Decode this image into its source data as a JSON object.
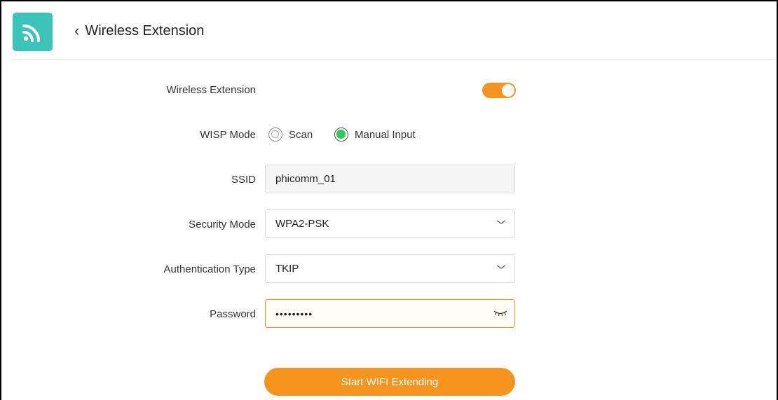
{
  "header": {
    "title": "Wireless Extension",
    "logo_icon": "wifi-signal-icon",
    "back_icon": "chevron-left-icon"
  },
  "form": {
    "wireless_extension": {
      "label": "Wireless Extension",
      "enabled": true
    },
    "wisp_mode": {
      "label": "WISP Mode",
      "options": [
        "Scan",
        "Manual Input"
      ],
      "selected": "Manual Input"
    },
    "ssid": {
      "label": "SSID",
      "value": "phicomm_01"
    },
    "security_mode": {
      "label": "Security Mode",
      "value": "WPA2-PSK"
    },
    "authentication_type": {
      "label": "Authentication Type",
      "value": "TKIP"
    },
    "password": {
      "label": "Password",
      "value": "•••••••••",
      "reveal_icon": "eye-closed-icon"
    }
  },
  "actions": {
    "start_label": "Start WIFI Extending"
  },
  "colors": {
    "accent": "#f7941d",
    "logo": "#3cc4b8",
    "radio_selected": "#2ecc57"
  }
}
